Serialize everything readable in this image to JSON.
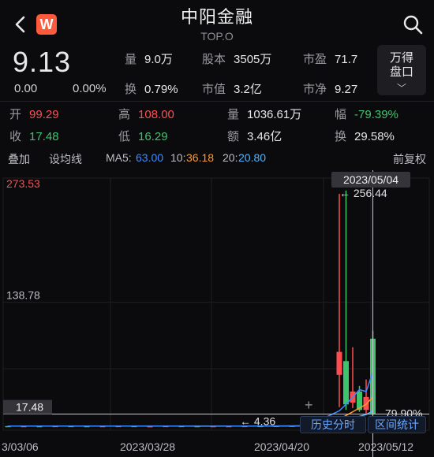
{
  "header": {
    "title": "中阳金融",
    "subtitle": "TOP.O",
    "brand_logo": "W"
  },
  "quote": {
    "price": "9.13",
    "change": "0.00",
    "change_pct": "0.00%",
    "stats_top": [
      {
        "label": "量",
        "value": "9.0万"
      },
      {
        "label": "股本",
        "value": "3505万"
      },
      {
        "label": "市盈",
        "value": "71.7"
      },
      {
        "label": "换",
        "value": "0.79%"
      },
      {
        "label": "市值",
        "value": "3.2亿"
      },
      {
        "label": "市净",
        "value": "9.27"
      }
    ],
    "wan_button": {
      "line1": "万得",
      "line2": "盘口",
      "chevron": "﹀"
    }
  },
  "daily": {
    "open": {
      "label": "开",
      "value": "99.29"
    },
    "high": {
      "label": "高",
      "value": "108.00"
    },
    "volume": {
      "label": "量",
      "value": "1036.61万"
    },
    "amplitude": {
      "label": "幅",
      "value": "-79.39%"
    },
    "close": {
      "label": "收",
      "value": "17.48"
    },
    "low": {
      "label": "低",
      "value": "16.29"
    },
    "amount": {
      "label": "额",
      "value": "3.46亿"
    },
    "turnover": {
      "label": "换",
      "value": "29.58%"
    }
  },
  "toolbar": {
    "overlay": "叠加",
    "set_ma": "设均线",
    "ma5_label": "MA5:",
    "ma5_value": "63.00",
    "ma10_label": "10:",
    "ma10_value": "36.18",
    "ma20_label": "20:",
    "ma20_value": "20.80",
    "adjust": "前复权"
  },
  "colors": {
    "up": "#ff4d4f",
    "down": "#3ec46d",
    "ma5": "#3d8bff",
    "ma10": "#ff9a2e",
    "ma20": "#4fb6ff"
  },
  "chart_data": {
    "type": "candlestick",
    "y_labels": {
      "max": "273.53",
      "mid": "138.78",
      "current": "17.48"
    },
    "annotations": {
      "peak": "256.44",
      "low_marker": "4.36",
      "ma_partial": "79.90%"
    },
    "x_labels": [
      "3/03/06",
      "2023/03/28",
      "2023/04/20",
      "2023/05/12"
    ],
    "crosshair_date": "2023/05/04",
    "ylim": [
      0,
      273.53
    ],
    "candles": [
      {
        "open": 4.5,
        "close": 4.3,
        "high": 4.6,
        "low": 4.2
      },
      {
        "open": 4.4,
        "close": 4.5,
        "high": 4.6,
        "low": 4.3
      },
      {
        "open": 4.5,
        "close": 4.4,
        "high": 4.6,
        "low": 4.3
      },
      {
        "open": 4.4,
        "close": 4.6,
        "high": 4.7,
        "low": 4.3
      },
      {
        "open": 4.6,
        "close": 4.5,
        "high": 4.7,
        "low": 4.4
      },
      {
        "open": 4.5,
        "close": 4.4,
        "high": 4.6,
        "low": 4.3
      },
      {
        "open": 4.4,
        "close": 4.5,
        "high": 4.6,
        "low": 4.3
      },
      {
        "open": 4.5,
        "close": 4.6,
        "high": 4.7,
        "low": 4.4
      },
      {
        "open": 4.6,
        "close": 4.4,
        "high": 4.7,
        "low": 4.3
      },
      {
        "open": 4.4,
        "close": 4.4,
        "high": 4.5,
        "low": 4.3
      },
      {
        "open": 4.4,
        "close": 4.6,
        "high": 4.7,
        "low": 4.3
      },
      {
        "open": 4.6,
        "close": 4.5,
        "high": 4.7,
        "low": 4.4
      },
      {
        "open": 4.5,
        "close": 4.4,
        "high": 4.6,
        "low": 4.36
      },
      {
        "open": 4.4,
        "close": 4.5,
        "high": 4.6,
        "low": 4.36
      },
      {
        "open": 4.5,
        "close": 4.5,
        "high": 4.6,
        "low": 4.4
      },
      {
        "open": 4.5,
        "close": 4.6,
        "high": 4.7,
        "low": 4.4
      },
      {
        "open": 4.6,
        "close": 4.5,
        "high": 4.8,
        "low": 4.4
      },
      {
        "open": 4.5,
        "close": 4.7,
        "high": 4.9,
        "low": 4.4
      },
      {
        "open": 4.7,
        "close": 4.8,
        "high": 5.2,
        "low": 4.6
      },
      {
        "open": 4.8,
        "close": 5.5,
        "high": 8.0,
        "low": 4.7
      },
      {
        "open": 60,
        "close": 85,
        "high": 256.44,
        "low": 25
      },
      {
        "open": 75,
        "close": 28,
        "high": 260,
        "low": 22
      },
      {
        "open": 30,
        "close": 42,
        "high": 90,
        "low": 24
      },
      {
        "open": 42,
        "close": 22,
        "high": 48,
        "low": 20
      },
      {
        "open": 22,
        "close": 36,
        "high": 55,
        "low": 18
      },
      {
        "open": 99.29,
        "close": 17.48,
        "high": 108.0,
        "low": 16.29
      }
    ],
    "ma5": [
      4.5,
      4.5,
      4.5,
      4.5,
      4.5,
      4.5,
      4.5,
      4.5,
      4.5,
      4.5,
      4.5,
      4.5,
      4.4,
      4.4,
      4.5,
      4.5,
      4.5,
      4.6,
      4.6,
      4.8,
      21,
      28,
      36,
      44,
      42,
      63.0
    ],
    "ma10": [
      null,
      null,
      null,
      null,
      null,
      null,
      null,
      null,
      null,
      4.5,
      4.5,
      4.5,
      4.5,
      4.5,
      4.5,
      4.5,
      4.5,
      4.5,
      4.6,
      4.7,
      12,
      16,
      20,
      24,
      28,
      36.18
    ],
    "ma20": [
      null,
      null,
      null,
      null,
      null,
      null,
      null,
      null,
      null,
      null,
      null,
      null,
      null,
      null,
      null,
      null,
      null,
      null,
      null,
      4.6,
      8,
      11,
      13,
      15,
      17,
      20.8
    ]
  },
  "chart_buttons": {
    "history": "历史分时",
    "interval": "区间统计",
    "plus": "+"
  }
}
